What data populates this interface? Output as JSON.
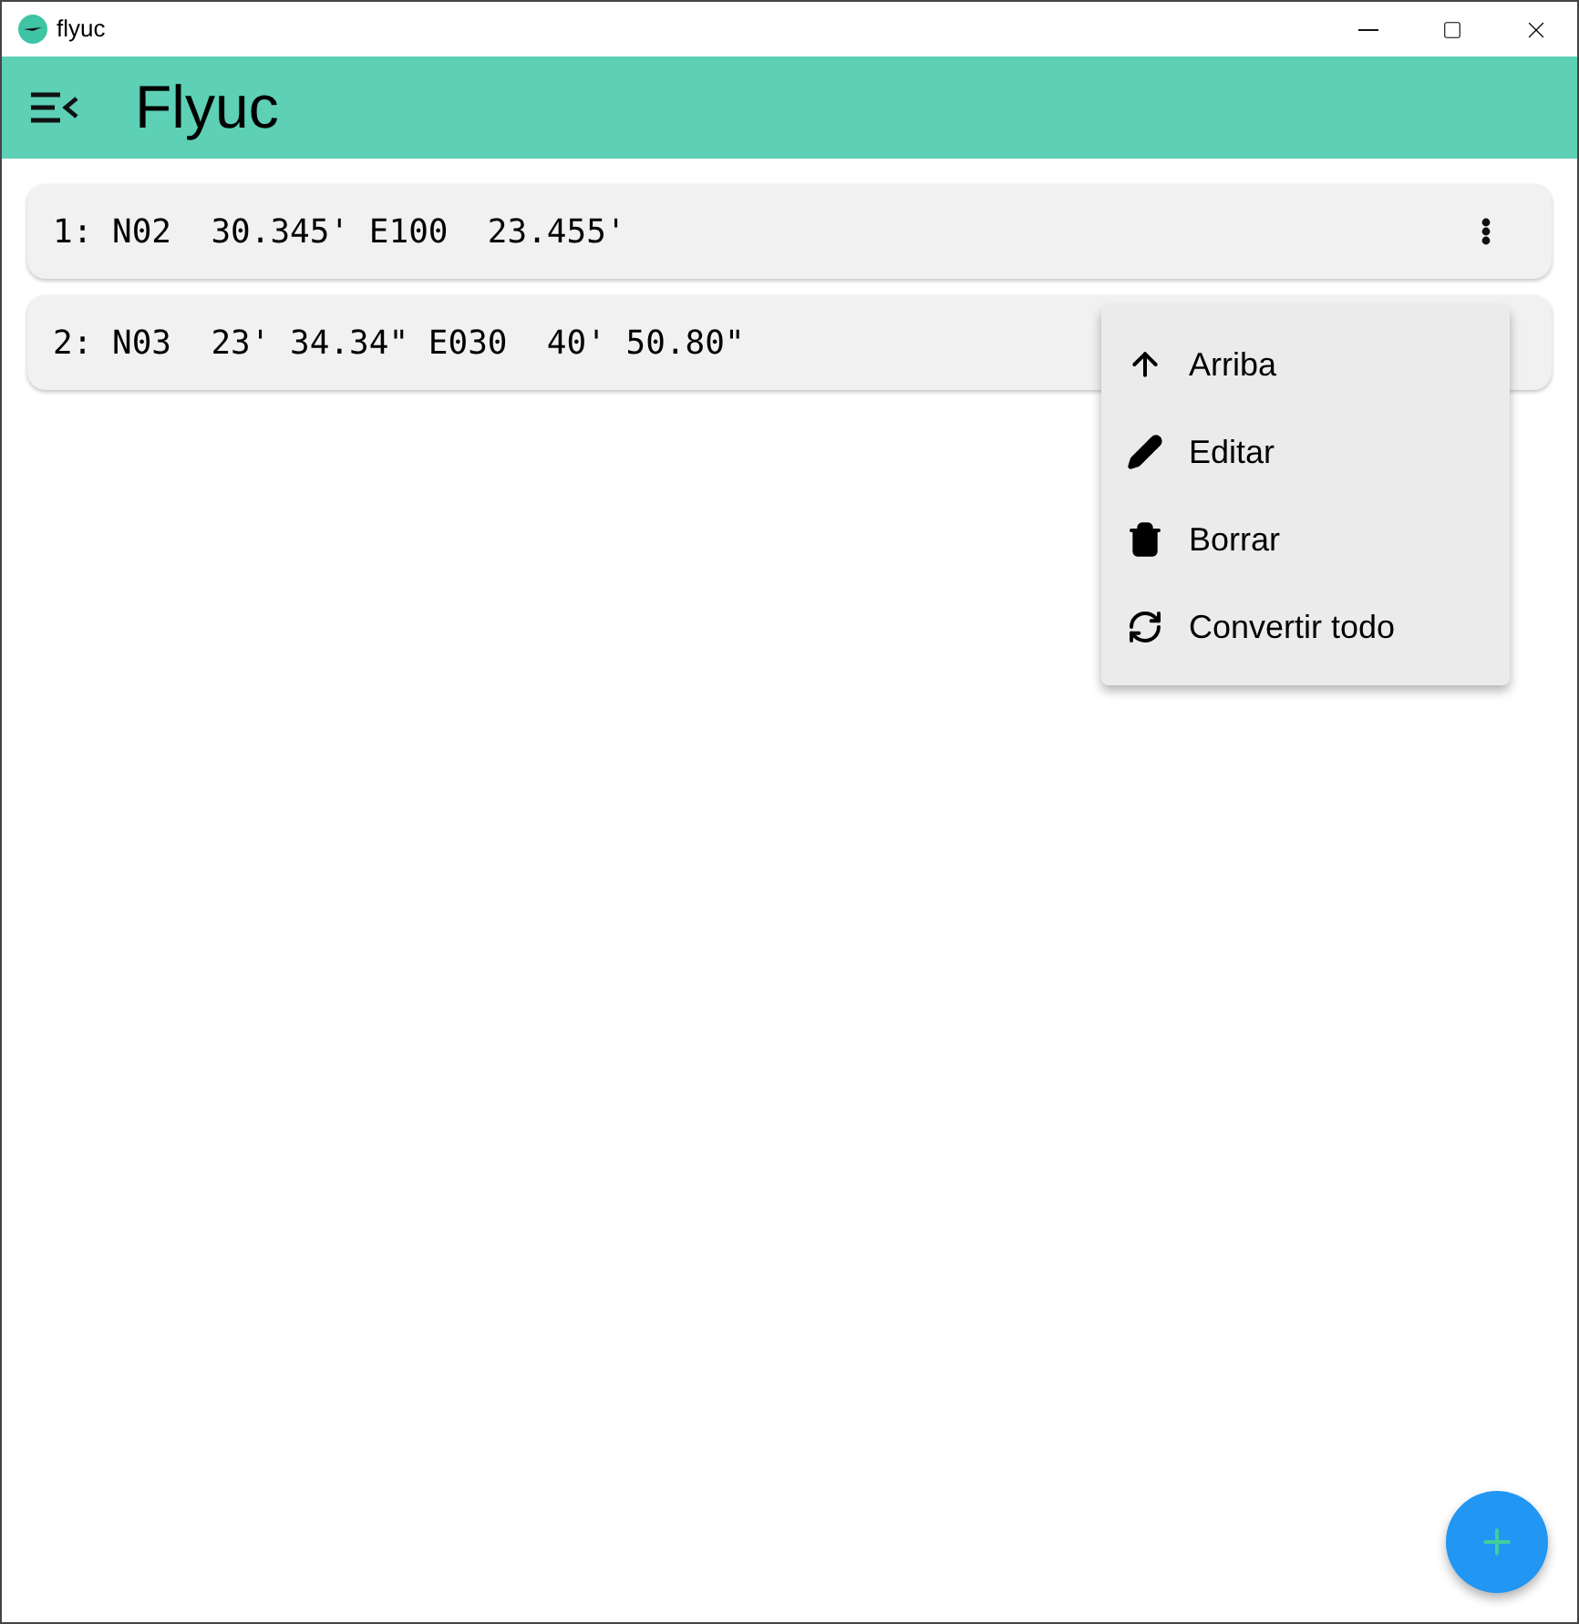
{
  "window": {
    "title": "flyuc"
  },
  "app_bar": {
    "title": "Flyuc"
  },
  "waypoints": [
    {
      "text": "1: N02  30.345' E100  23.455'",
      "has_menu_button": true
    },
    {
      "text": "2: N03  23' 34.34\" E030  40' 50.80\"",
      "has_menu_button": false
    }
  ],
  "context_menu": {
    "items": [
      "Arriba",
      "Editar",
      "Borrar",
      "Convertir todo"
    ]
  }
}
